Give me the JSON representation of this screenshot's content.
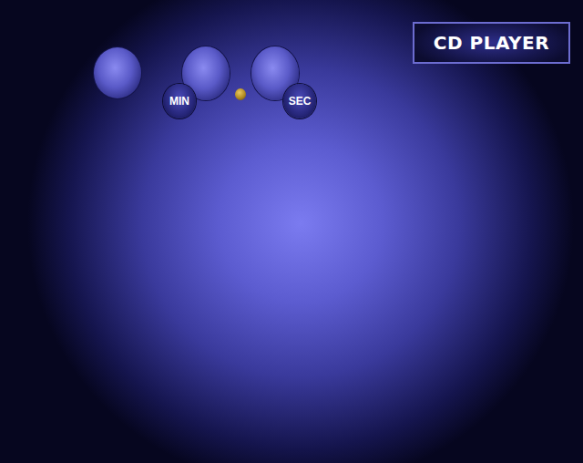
{
  "window": {
    "title": "CD PLAYER"
  },
  "time_labels": [
    {
      "label": "MIN"
    },
    {
      "label": "SEC"
    }
  ],
  "separator_light": {
    "on": true
  }
}
